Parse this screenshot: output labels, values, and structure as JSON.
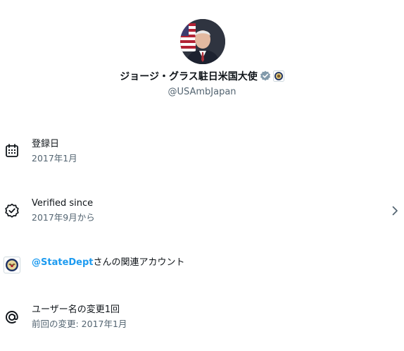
{
  "profile": {
    "display_name": "ジョージ・グラス駐日米国大使",
    "handle": "@USAmbJapan"
  },
  "rows": {
    "joined": {
      "label": "登録日",
      "value": "2017年1月",
      "icon": "calendar-icon"
    },
    "verified": {
      "label": "Verified since",
      "value": "2017年9月から",
      "icon": "verified-check-icon"
    },
    "affiliation": {
      "mention": "@StateDept",
      "suffix": "さんの関連アカウント",
      "icon": "state-dept-seal-icon"
    },
    "username_changes": {
      "label": "ユーザー名の変更1回",
      "value": "前回の変更: 2017年1月",
      "icon": "at-sign-icon"
    }
  },
  "colors": {
    "text_primary": "#0f1419",
    "text_secondary": "#536471",
    "accent": "#1d9bf0",
    "verified_badge": "#829aab"
  }
}
